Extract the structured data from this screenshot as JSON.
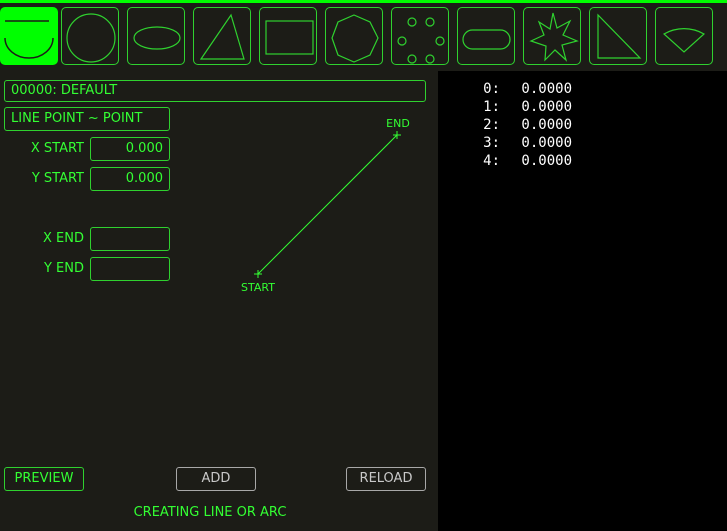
{
  "toolbar": {
    "tools": [
      {
        "name": "arc-tool",
        "icon": "arc-icon"
      },
      {
        "name": "circle-tool",
        "icon": "circle-icon"
      },
      {
        "name": "ellipse-tool",
        "icon": "ellipse-icon"
      },
      {
        "name": "triangle-tool",
        "icon": "triangle-icon"
      },
      {
        "name": "rectangle-tool",
        "icon": "rectangle-icon"
      },
      {
        "name": "polygon-tool",
        "icon": "heptagon-icon"
      },
      {
        "name": "bolt-circle-tool",
        "icon": "bolt-circle-icon"
      },
      {
        "name": "slot-tool",
        "icon": "obround-icon"
      },
      {
        "name": "star-tool",
        "icon": "star-icon"
      },
      {
        "name": "right-triangle-tool",
        "icon": "right-triangle-icon"
      },
      {
        "name": "sector-tool",
        "icon": "sector-icon"
      }
    ],
    "active_tool": "arc-tool"
  },
  "form": {
    "program_name": "00000: DEFAULT",
    "mode": "LINE POINT ~ POINT",
    "x_start_label": "X START",
    "x_start_value": "0.000",
    "y_start_label": "Y START",
    "y_start_value": "0.000",
    "x_end_label": "X END",
    "x_end_value": "",
    "y_end_label": "Y END",
    "y_end_value": ""
  },
  "diagram": {
    "start_label": "START",
    "end_label": "END"
  },
  "buttons": {
    "preview": "PREVIEW",
    "add": "ADD",
    "reload": "RELOAD"
  },
  "status": "CREATING LINE OR ARC",
  "params": [
    {
      "index": "0:",
      "value": "0.0000"
    },
    {
      "index": "1:",
      "value": "0.0000"
    },
    {
      "index": "2:",
      "value": "0.0000"
    },
    {
      "index": "3:",
      "value": "0.0000"
    },
    {
      "index": "4:",
      "value": "0.0000"
    }
  ],
  "colors": {
    "accent": "#00ff00",
    "panel_bg": "#1c1c17",
    "text": "#33ff33"
  }
}
